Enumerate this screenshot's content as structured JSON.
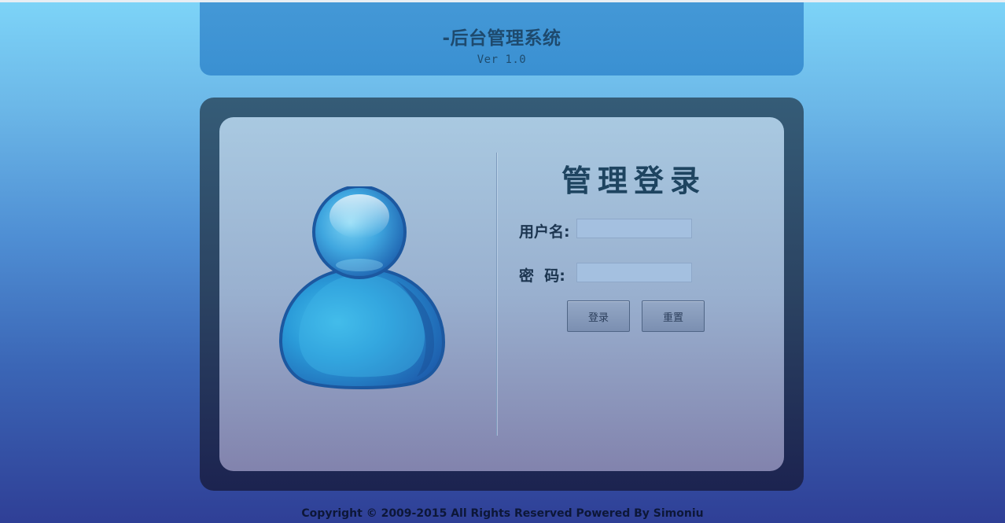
{
  "header": {
    "title": "-后台管理系统",
    "version": "Ver 1.0"
  },
  "login": {
    "title": "管理登录",
    "username_label": "用户名:",
    "username_value": "",
    "password_label": "密  码:",
    "password_value": "",
    "login_button": "登录",
    "reset_button": "重置"
  },
  "footer": {
    "copyright": "Copyright © 2009-2015 All Rights Reserved Powered By Simoniu"
  },
  "icons": {
    "avatar": "user-avatar-icon"
  },
  "colors": {
    "header_bg": "#4498d6",
    "panel_dark": "#2b4362",
    "panel_light": "#a9c9e1",
    "title_text": "#1e4460",
    "avatar_blue": "#2a8fd6"
  }
}
